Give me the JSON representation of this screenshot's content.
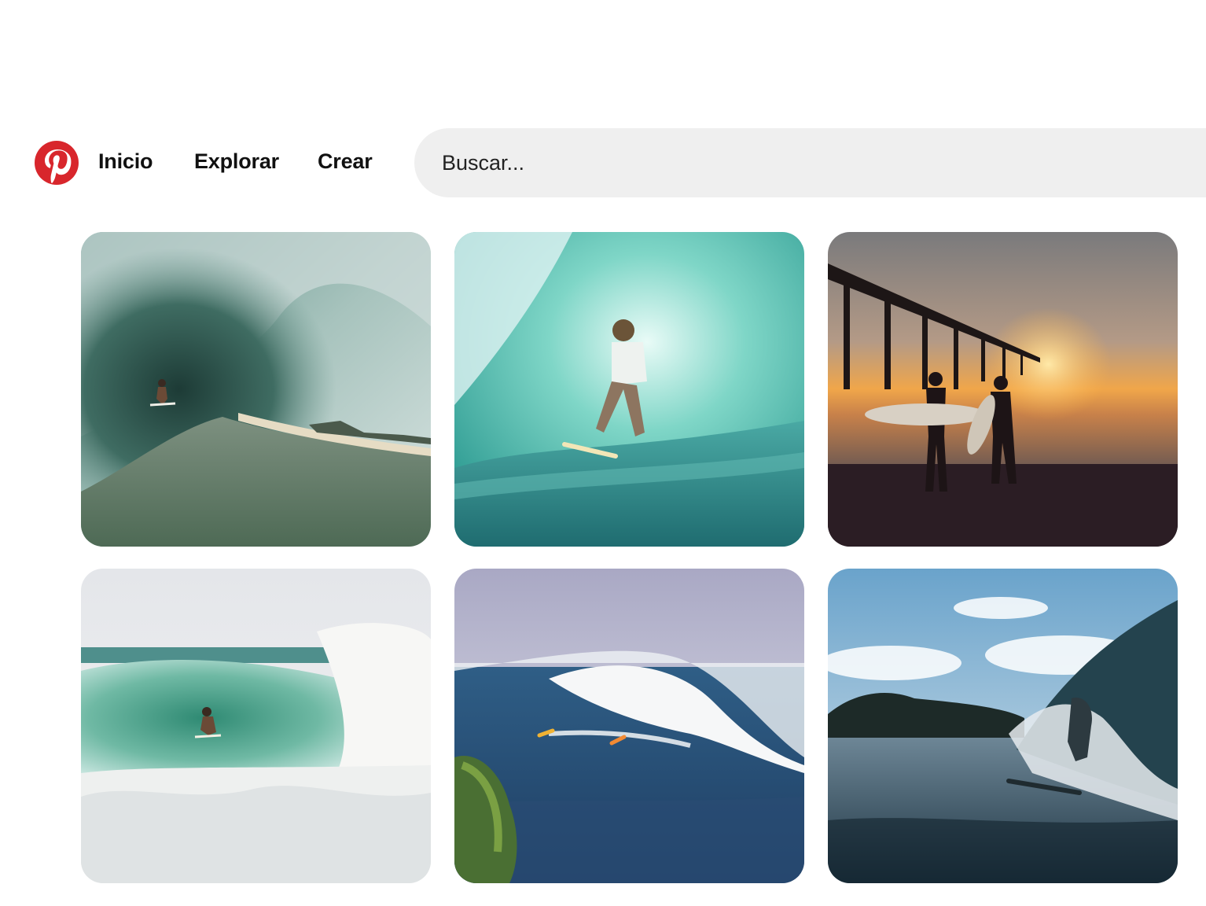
{
  "brand": {
    "color": "#d8262c",
    "logo_icon": "pinterest-logo-icon"
  },
  "nav": {
    "inicio": "Inicio",
    "explorar": "Explorar",
    "crear": "Crear"
  },
  "search": {
    "placeholder": "Buscar..."
  },
  "pins": [
    {
      "subject": "surfer inside barrel wave"
    },
    {
      "subject": "surfer in turquoise wave"
    },
    {
      "subject": "surfers at pier sunset"
    },
    {
      "subject": "surfer in green barrel"
    },
    {
      "subject": "surfers on big wave"
    },
    {
      "subject": "surfer on dark wave"
    }
  ]
}
